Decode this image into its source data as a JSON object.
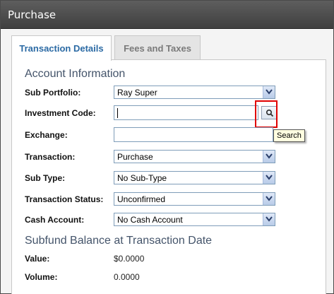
{
  "window": {
    "title": "Purchase"
  },
  "tabs": [
    {
      "label": "Transaction Details",
      "active": true
    },
    {
      "label": "Fees and Taxes",
      "active": false
    }
  ],
  "account_section": {
    "title": "Account Information",
    "fields": {
      "sub_portfolio": {
        "label": "Sub Portfolio:",
        "value": "Ray Super"
      },
      "investment_code": {
        "label": "Investment Code:",
        "value": ""
      },
      "exchange": {
        "label": "Exchange:",
        "value": ""
      },
      "transaction": {
        "label": "Transaction:",
        "value": "Purchase"
      },
      "sub_type": {
        "label": "Sub Type:",
        "value": "No Sub-Type"
      },
      "transaction_status": {
        "label": "Transaction Status:",
        "value": "Unconfirmed"
      },
      "cash_account": {
        "label": "Cash Account:",
        "value": "No Cash Account"
      }
    }
  },
  "search_button": {
    "icon": "search-icon",
    "tooltip": "Search"
  },
  "balance_section": {
    "title": "Subfund Balance at Transaction Date",
    "value_label": "Value:",
    "value": "$0.0000",
    "volume_label": "Volume:",
    "volume": "0.0000"
  },
  "colors": {
    "title_bar": "#4f4f4f",
    "active_tab_text": "#2b6aa4",
    "section_title": "#44546a",
    "highlight": "#e00000",
    "tooltip_bg": "#fffee0"
  }
}
